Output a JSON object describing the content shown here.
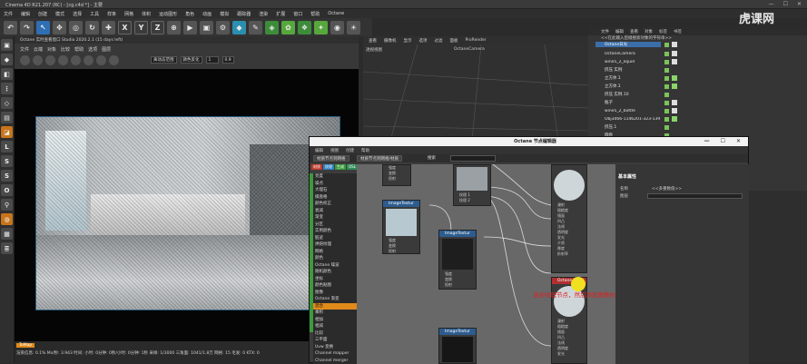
{
  "window": {
    "title": "Cinema 4D R21.207 (RC) - [cg.c4d *] - 主要",
    "controls": [
      "—",
      "☐",
      "✕"
    ]
  },
  "menubar": [
    "文件",
    "编辑",
    "创建",
    "模式",
    "选择",
    "工具",
    "样条",
    "网格",
    "体积",
    "运动图形",
    "角色",
    "动画",
    "模拟",
    "跟踪器",
    "渲染",
    "扩展",
    "窗口",
    "帮助",
    "Octane"
  ],
  "watermark": "虎课网",
  "toolbar": {
    "xyz": [
      "X",
      "Y",
      "Z"
    ]
  },
  "viewport": {
    "menu": [
      "查看",
      "摄像机",
      "显示",
      "选项",
      "过滤",
      "面板",
      "ProRender"
    ],
    "octane_title": "Octane 实时查看窗口 Studio 2020.2.1 (15 days left)",
    "menu2": [
      "文件",
      "云端",
      "对象",
      "比较",
      "帮助",
      "选项",
      "图层"
    ],
    "select1": "离动态范围",
    "select2": "颜色反化",
    "select3": "0.9",
    "status_tag": "ToMap",
    "status_text": "渲染信息: 0.1%  Ms/秒: 3.943  时间: 小时: 0分钟: 0秒/小时: 0分钟: 1秒  采样: 1/3000  三角面: 1041/1.8万  网格: 15  毛发: 0  KTX: 0"
  },
  "right_view": {
    "menu": [
      "查看",
      "摄像机",
      "显示",
      "选项",
      "过滤",
      "面板",
      "ProRender"
    ],
    "label": "透视视图",
    "camera": "OctaneCamera"
  },
  "object_manager": {
    "tabs": [
      "文件",
      "编辑",
      "查看",
      "对象",
      "标签",
      "书签"
    ],
    "path": "<<在此输入后缀搜索对象的字符串>>",
    "objects": [
      {
        "name": "Octane日光",
        "selected": true
      },
      {
        "name": "OctaneCamera",
        "selected": false
      },
      {
        "name": "wine5_2_liquid",
        "selected": false
      },
      {
        "name": "挤压 实例",
        "selected": false
      },
      {
        "name": "立方体.1",
        "selected": false
      },
      {
        "name": "立方体.1",
        "selected": false
      },
      {
        "name": "挤压 实例.10",
        "selected": false
      },
      {
        "name": "瓶子",
        "selected": false
      },
      {
        "name": "wine5_2_bottle",
        "selected": false
      },
      {
        "name": "Obj3d66-1146201-323-139",
        "selected": false
      },
      {
        "name": "挤压.1",
        "selected": false
      },
      {
        "name": "圆盘",
        "selected": false
      }
    ]
  },
  "node_editor": {
    "title": "Octane 节点编辑器",
    "controls": [
      "—",
      "☐",
      "✕"
    ],
    "menu": [
      "编辑",
      "视图",
      "创建",
      "帮助"
    ],
    "btn1": "材质节点到网格",
    "btn2": "材质节点到网格/材质",
    "search_label": "搜索",
    "categories": [
      {
        "label": "材质",
        "color": "#c0392b"
      },
      {
        "label": "纹理",
        "color": "#2f7fc1"
      },
      {
        "label": "生成",
        "color": "#3a9a3a"
      },
      {
        "label": "OSL",
        "color": "#2e8b57"
      },
      {
        "label": "映射",
        "color": "#b03a8a"
      },
      {
        "label": "发光",
        "color": "#c07a20"
      },
      {
        "label": "介质",
        "color": "#7a4fb0"
      },
      {
        "label": "值",
        "color": "#3a7ab0"
      },
      {
        "label": "其他",
        "color": "#5a8a5a"
      },
      {
        "label": "CAD",
        "color": "#888888"
      }
    ],
    "list": [
      {
        "label": "亮度",
        "sel": false
      },
      {
        "label": "噪点",
        "sel": false
      },
      {
        "label": "大理石",
        "sel": false
      },
      {
        "label": "棋盘格",
        "sel": false
      },
      {
        "label": "颜色校正",
        "sel": false
      },
      {
        "label": "衰减",
        "sel": false
      },
      {
        "label": "渐变",
        "sel": false
      },
      {
        "label": "分区",
        "sel": false
      },
      {
        "label": "实例颜色",
        "sel": false
      },
      {
        "label": "脏迹",
        "sel": false
      },
      {
        "label": "烘焙纹理",
        "sel": false
      },
      {
        "label": "网格",
        "sel": false
      },
      {
        "label": "颜色",
        "sel": false
      },
      {
        "label": "Octane 噪波",
        "sel": false
      },
      {
        "label": "随机颜色",
        "sel": false
      },
      {
        "label": "坐标",
        "sel": false
      },
      {
        "label": "颜色贴图",
        "sel": false
      },
      {
        "label": "图像",
        "sel": false
      },
      {
        "label": "Octane 渐变",
        "sel": false
      },
      {
        "label": "混合",
        "sel": true
      },
      {
        "label": "乘积",
        "sel": false
      },
      {
        "label": "相加",
        "sel": false
      },
      {
        "label": "相减",
        "sel": false
      },
      {
        "label": "比较",
        "sel": false
      },
      {
        "label": "三平面",
        "sel": false
      },
      {
        "label": "Uvw 变换",
        "sel": false
      },
      {
        "label": "Channel mapper",
        "sel": false
      },
      {
        "label": "Channel merger",
        "sel": false
      }
    ],
    "nodes": {
      "image1": "ImageTextur",
      "image2": "ImageTextur",
      "image3": "ImageTextur",
      "mat": "Octane 材质1",
      "pins": [
        "强度",
        "变换",
        "投射",
        "伽玛"
      ],
      "mat_pins": [
        "漫射",
        "粗糙度",
        "镜面",
        "凹凸",
        "法线",
        "透明度",
        "发光",
        "介质",
        "厚度",
        "折射率"
      ],
      "out1": "纹理 1",
      "out2": "纹理 2"
    },
    "annotation": "混合纹理节点，然后添加图像纹理",
    "props": {
      "heading": "基本属性",
      "name_label": "名称",
      "name_value": "<<多重数值>>",
      "layer_label": "图层"
    }
  }
}
